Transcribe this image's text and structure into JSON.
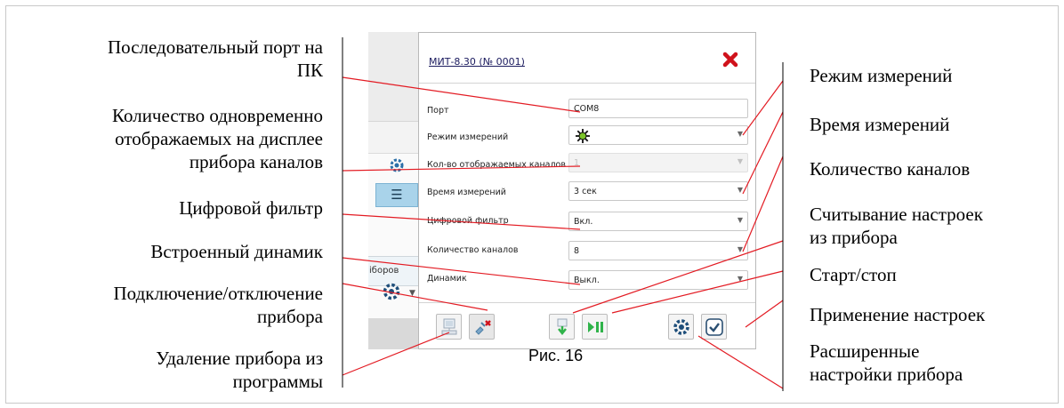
{
  "dialog": {
    "title": "МИТ-8.30 (№ 0001)",
    "fields": [
      {
        "label": "Порт",
        "value": "COM8",
        "type": "text"
      },
      {
        "label": "Режим измерений",
        "value": "",
        "type": "select-icon"
      },
      {
        "label": "Кол-во отображаемых каналов",
        "value": "1",
        "type": "select-disabled"
      },
      {
        "label": "Время измерений",
        "value": "3 сек",
        "type": "select"
      },
      {
        "label": "Цифровой фильтр",
        "value": "Вкл.",
        "type": "select"
      },
      {
        "label": "Количество каналов",
        "value": "8",
        "type": "select"
      },
      {
        "label": "Динамик",
        "value": "Выкл.",
        "type": "select"
      }
    ],
    "buttons": [
      {
        "name": "connect-device-button",
        "icon": "computer-icon"
      },
      {
        "name": "delete-device-button",
        "icon": "disconnect-plug-icon"
      },
      {
        "name": "read-settings-button",
        "icon": "download-arrow-icon"
      },
      {
        "name": "start-stop-button",
        "icon": "play-pause-icon"
      },
      {
        "name": "advanced-settings-button",
        "icon": "gear-icon"
      },
      {
        "name": "apply-settings-button",
        "icon": "checkmark-icon"
      }
    ],
    "colors": {
      "close": "#d0121b",
      "play": "#2fb34a",
      "accent": "#7cc52a"
    }
  },
  "background_app": {
    "tab_label": "іборов",
    "menu_icon": "hamburger-icon"
  },
  "callouts_left": [
    {
      "text": "Последовательный порт на\nПК"
    },
    {
      "text": "Количество одновременно\nотображаемых на дисплее\nприбора каналов"
    },
    {
      "text": "Цифровой фильтр"
    },
    {
      "text": "Встроенный динамик"
    },
    {
      "text": "Подключение/отключение\nприбора"
    },
    {
      "text": "Удаление прибора из\nпрограммы"
    }
  ],
  "callouts_right": [
    {
      "text": "Режим измерений"
    },
    {
      "text": "Время измерений"
    },
    {
      "text": "Количество каналов"
    },
    {
      "text": "Считывание настроек\nиз прибора"
    },
    {
      "text": "Старт/стоп"
    },
    {
      "text": "Применение настроек"
    },
    {
      "text": "Расширенные\nнастройки прибора"
    }
  ],
  "caption": "Рис. 16"
}
